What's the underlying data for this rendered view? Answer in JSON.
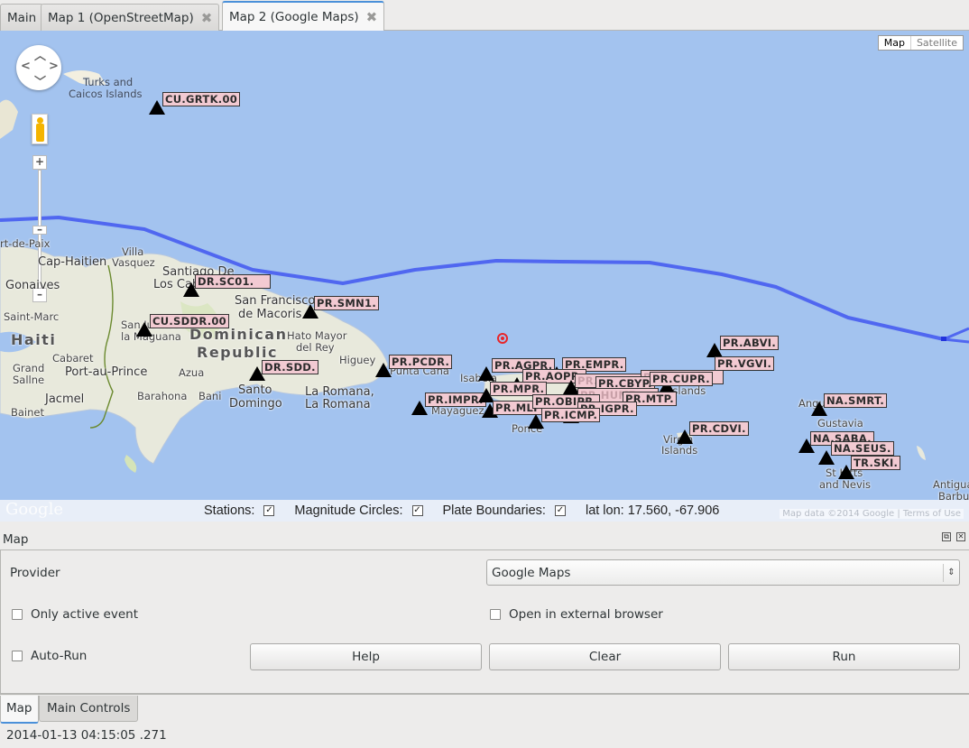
{
  "tabs": [
    {
      "label": "Main",
      "closable": false,
      "active": false
    },
    {
      "label": "Map 1 (OpenStreetMap)",
      "closable": true,
      "active": false
    },
    {
      "label": "Map 2 (Google Maps)",
      "closable": true,
      "active": true
    }
  ],
  "map": {
    "map_type": {
      "selected": "Map",
      "other": "Satellite"
    },
    "plate_boundary_color": "#5067f0",
    "event_color": "#e8262a",
    "places": [
      {
        "text": "Turks and",
        "cls": "sea"
      },
      {
        "text": "Caicos Islands",
        "cls": "sea"
      },
      {
        "text": "rt-de-Paix",
        "cls": ""
      },
      {
        "text": "Cap-Haitien",
        "cls": "big"
      },
      {
        "text": "Villa",
        "cls": ""
      },
      {
        "text": "Vasquez",
        "cls": ""
      },
      {
        "text": "Santiago De",
        "cls": "big"
      },
      {
        "text": "Los Caballeros",
        "cls": "big"
      },
      {
        "text": "Gonaives",
        "cls": "big"
      },
      {
        "text": "San Francisco",
        "cls": "big"
      },
      {
        "text": "de Macoris",
        "cls": "big"
      },
      {
        "text": "Saint-Marc",
        "cls": ""
      },
      {
        "text": "Haiti",
        "cls": "country"
      },
      {
        "text": "San Juan de",
        "cls": ""
      },
      {
        "text": "la Maguana",
        "cls": ""
      },
      {
        "text": "Dominican",
        "cls": "country"
      },
      {
        "text": "Republic",
        "cls": "country"
      },
      {
        "text": "Hato Mayor",
        "cls": ""
      },
      {
        "text": "del Rey",
        "cls": ""
      },
      {
        "text": "Cabaret",
        "cls": ""
      },
      {
        "text": "Higuey",
        "cls": ""
      },
      {
        "text": "Grand",
        "cls": ""
      },
      {
        "text": "Sallne",
        "cls": ""
      },
      {
        "text": "Port-au-Prince",
        "cls": "big"
      },
      {
        "text": "Azua",
        "cls": ""
      },
      {
        "text": "Punta Cana",
        "cls": ""
      },
      {
        "text": "Santo",
        "cls": "big"
      },
      {
        "text": "Domingo",
        "cls": "big"
      },
      {
        "text": "La Romana,",
        "cls": "big"
      },
      {
        "text": "La Romana",
        "cls": "big"
      },
      {
        "text": "Jacmel",
        "cls": "big"
      },
      {
        "text": "Barahona",
        "cls": ""
      },
      {
        "text": "Bani",
        "cls": ""
      },
      {
        "text": "Bainet",
        "cls": ""
      },
      {
        "text": "Isabela",
        "cls": ""
      },
      {
        "text": "Mayaguez",
        "cls": ""
      },
      {
        "text": "Ponce",
        "cls": ""
      },
      {
        "text": "Virgin",
        "cls": ""
      },
      {
        "text": "Islands",
        "cls": ""
      },
      {
        "text": "Islands",
        "cls": ""
      },
      {
        "text": "Anguilla",
        "cls": ""
      },
      {
        "text": "Gustavia",
        "cls": ""
      },
      {
        "text": "St Kitts",
        "cls": ""
      },
      {
        "text": "and Nevis",
        "cls": ""
      },
      {
        "text": "Antigua",
        "cls": ""
      },
      {
        "text": "Barbu",
        "cls": ""
      }
    ],
    "stations": [
      {
        "label": "CU.GRTK.00"
      },
      {
        "label": "DR.SC01."
      },
      {
        "label": "PR.SMN1."
      },
      {
        "label": "CU.SDDR.00"
      },
      {
        "label": "DR.SDD."
      },
      {
        "label": "PR.PCDR."
      },
      {
        "label": "PR.IMPR."
      },
      {
        "label": "PR.AGPR."
      },
      {
        "label": "PR.EMPR."
      },
      {
        "label": "PR.AOPR."
      },
      {
        "label": "PR.MPR."
      },
      {
        "label": "PR.CBYP."
      },
      {
        "label": "PR.CUPR."
      },
      {
        "label": "PR.MTP."
      },
      {
        "label": "PR.MLPR."
      },
      {
        "label": "PR.OBIPR."
      },
      {
        "label": "PR.IGPR."
      },
      {
        "label": "PR.ICMP."
      },
      {
        "label": "PR.ABVI."
      },
      {
        "label": "PR.VGVI."
      },
      {
        "label": "PR.CDVI."
      },
      {
        "label": "NA.SMRT."
      },
      {
        "label": "NA.SABA."
      },
      {
        "label": "NA.SEUS."
      },
      {
        "label": "TR.SKI."
      }
    ],
    "google_logo": "Google",
    "attribution": "Map data ©2014 Google | Terms of Use"
  },
  "statusbar": {
    "stations_label": "Stations:",
    "stations_checked": true,
    "magnitude_label": "Magnitude Circles:",
    "magnitude_checked": true,
    "plates_label": "Plate Boundaries:",
    "plates_checked": true,
    "latlon_label": "lat lon:",
    "latlon_value": "17.560, -67.906"
  },
  "dock": {
    "title": "Map",
    "provider_label": "Provider",
    "provider_value": "Google Maps",
    "only_active_label": "Only active event",
    "only_active_checked": false,
    "external_label": "Open in external browser",
    "external_checked": false,
    "autorun_label": "Auto-Run",
    "autorun_checked": false,
    "help_label": "Help",
    "clear_label": "Clear",
    "run_label": "Run"
  },
  "bottom_tabs": [
    {
      "label": "Map",
      "active": true
    },
    {
      "label": "Main Controls",
      "active": false
    }
  ],
  "status_time": "2014-01-13 04:15:05 .271"
}
